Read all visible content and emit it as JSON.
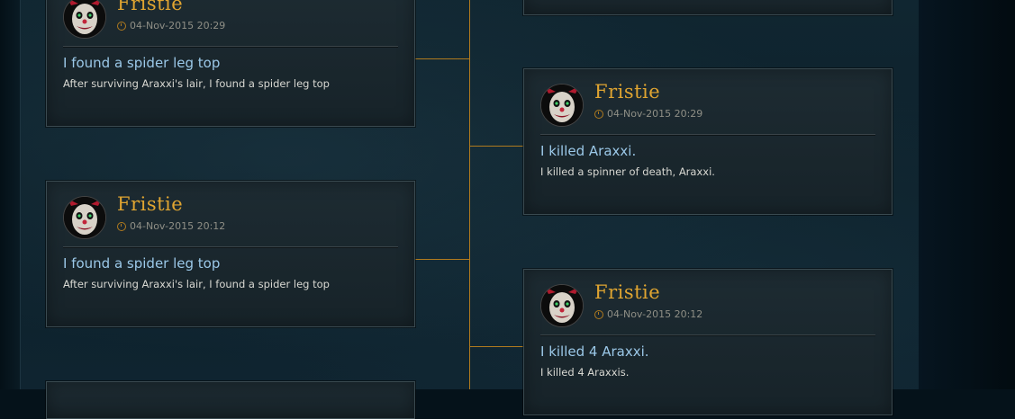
{
  "cards": [
    {
      "name": "Fristie",
      "timestamp": "04-Nov-2015 20:29",
      "title": "I found a spider leg top",
      "description": "After surviving Araxxi's lair, I found a spider leg top",
      "avatar_icon": "clown-avatar-icon"
    },
    {
      "name": "Fristie",
      "timestamp": "04-Nov-2015 20:29",
      "title": "I killed Araxxi.",
      "description": "I killed a spinner of death, Araxxi.",
      "avatar_icon": "clown-avatar-icon"
    },
    {
      "name": "Fristie",
      "timestamp": "04-Nov-2015 20:12",
      "title": "I found a spider leg top",
      "description": "After surviving Araxxi's lair, I found a spider leg top",
      "avatar_icon": "clown-avatar-icon"
    },
    {
      "name": "Fristie",
      "timestamp": "04-Nov-2015 20:12",
      "title": "I killed 4 Araxxi.",
      "description": "I killed 4 Araxxis.",
      "avatar_icon": "clown-avatar-icon"
    }
  ],
  "colors": {
    "accent": "#e0a531",
    "title": "#9bc8e8",
    "timeline": "#b07a1e"
  }
}
